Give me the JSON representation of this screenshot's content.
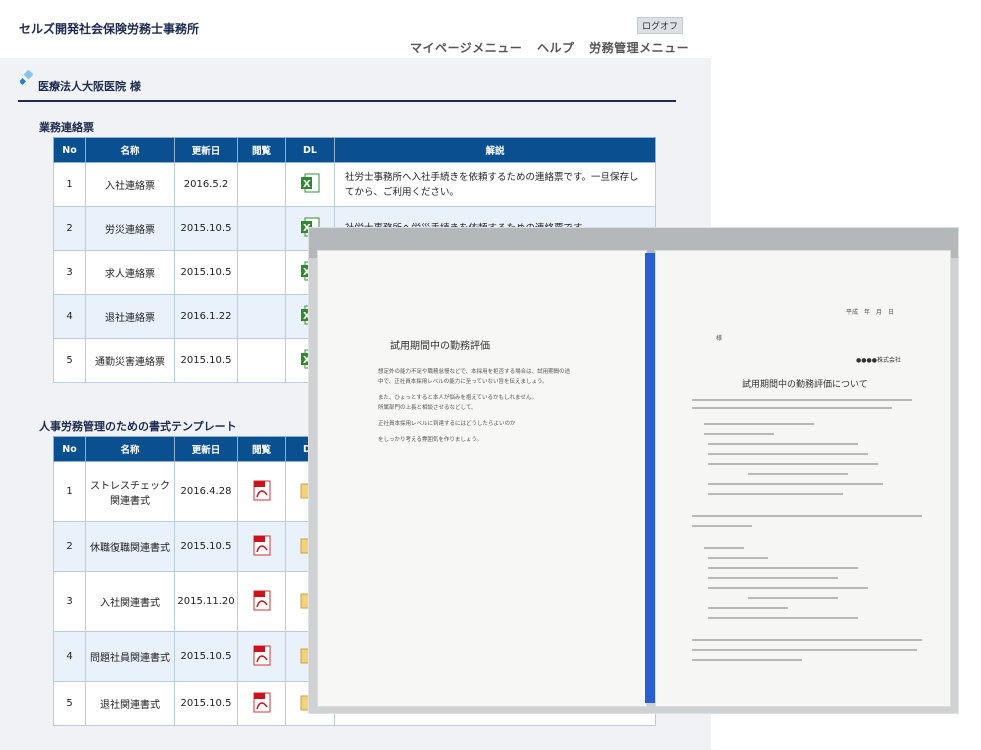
{
  "header": {
    "firm_name": "セルズ開発社会保険労務士事務所",
    "logout_label": "ログオフ",
    "nav": [
      "マイページメニュー",
      "ヘルプ",
      "労務管理メニュー"
    ]
  },
  "client": {
    "name": "医療法人大阪医院 様"
  },
  "section1": {
    "title": "業務連絡票",
    "columns": [
      "No",
      "名称",
      "更新日",
      "閲覧",
      "DL",
      "解説"
    ],
    "rows": [
      {
        "no": "1",
        "name": "入社連絡票",
        "date": "2016.5.2",
        "desc": "社労士事務所へ入社手続きを依頼するための連絡票です。一旦保存してから、ご利用ください。"
      },
      {
        "no": "2",
        "name": "労災連絡票",
        "date": "2015.10.5",
        "desc": "社労士事務所へ労災手続きを依頼するための連絡票です。"
      },
      {
        "no": "3",
        "name": "求人連絡票",
        "date": "2015.10.5",
        "desc": ""
      },
      {
        "no": "4",
        "name": "退社連絡票",
        "date": "2016.1.22",
        "desc": ""
      },
      {
        "no": "5",
        "name": "通勤災害連絡票",
        "date": "2015.10.5",
        "desc": ""
      }
    ]
  },
  "section2": {
    "title": "人事労務管理のための書式テンプレート",
    "columns": [
      "No",
      "名称",
      "更新日",
      "閲覧",
      "DL"
    ],
    "rows": [
      {
        "no": "1",
        "name": "ストレスチェック関連書式",
        "date": "2016.4.28"
      },
      {
        "no": "2",
        "name": "休職復職関連書式",
        "date": "2015.10.5"
      },
      {
        "no": "3",
        "name": "入社関連書式",
        "date": "2015.11.20"
      },
      {
        "no": "4",
        "name": "問題社員関連書式",
        "date": "2015.10.5"
      },
      {
        "no": "5",
        "name": "退社関連書式",
        "date": "2015.10.5"
      }
    ]
  },
  "photo": {
    "left_title": "試用期間中の勤務評価",
    "left_lines": [
      "想定外の能力不足や職務怠慢などで、本採用を拒否する場合は、試用期間の途",
      "中で、正社員本採用レベルの能力に至っていない旨を伝えましょう。",
      "また、ひょっとすると本人が悩みを抱えているかもしれません。",
      "所属部門の上長と相談させるなどして、",
      "正社員本採用レベルに到達するにはどうしたらよいのか",
      "をしっかり考える雰囲気を作りましょう。"
    ],
    "right_date": "平成　年　月　日",
    "right_to": "様",
    "right_company": "●●●●株式会社",
    "right_title": "試用期間中の勤務評価について"
  }
}
